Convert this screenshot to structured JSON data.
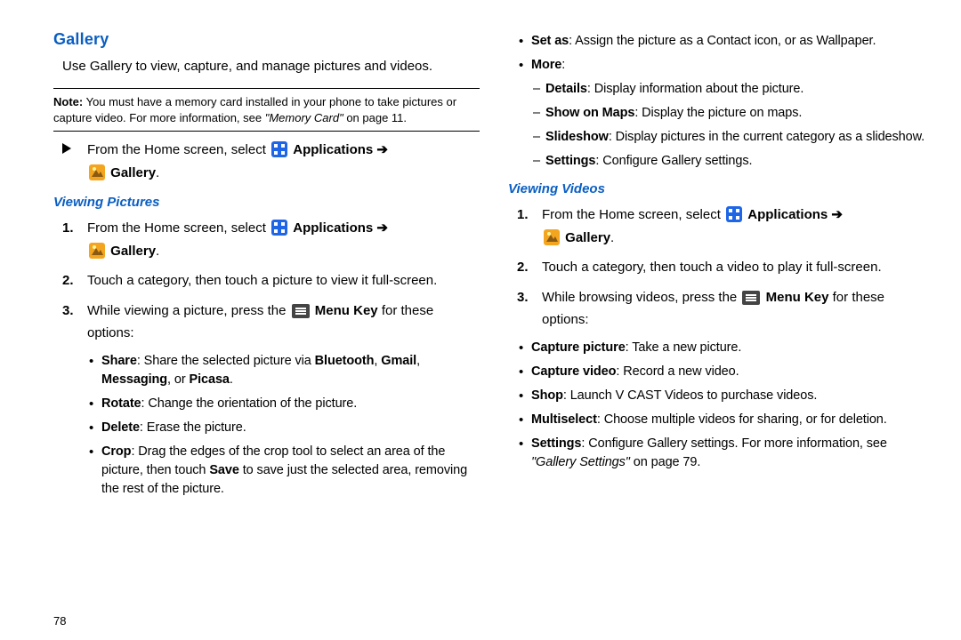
{
  "pageNumber": "78",
  "sectionTitle": "Gallery",
  "intro": "Use Gallery to view, capture, and manage pictures and videos.",
  "note": {
    "label": "Note:",
    "text": "You must have a memory card installed in your phone to take pictures or capture video. For more information, see ",
    "xref": "\"Memory Card\"",
    "tail": " on page 11."
  },
  "navStep": {
    "prefix": "From the Home screen, select ",
    "apps": "Applications",
    "arrow": " ➔ ",
    "gallery": "Gallery",
    "period": "."
  },
  "sub1": "Viewing Pictures",
  "vpSteps": {
    "n1": "1.",
    "s1_prefix": "From the Home screen, select ",
    "s1_apps": "Applications",
    "s1_arrow": " ➔ ",
    "s1_gallery": "Gallery",
    "s1_period": ".",
    "n2": "2.",
    "s2": "Touch a category, then touch a picture to view it full-screen.",
    "n3": "3.",
    "s3_prefix": "While viewing a picture, press the ",
    "s3_menu": "Menu Key",
    "s3_tail": " for these options:"
  },
  "vpBullets": {
    "share": {
      "lead": "Share",
      "rest": ": Share the selected picture via ",
      "a": "Bluetooth",
      "c1": ", ",
      "b": "Gmail",
      "c2": ", ",
      "c": "Messaging",
      "c3": ", or ",
      "d": "Picasa",
      "end": "."
    },
    "rotate": {
      "lead": "Rotate",
      "rest": ": Change the orientation of the picture."
    },
    "delete": {
      "lead": "Delete",
      "rest": ": Erase the picture."
    },
    "crop": {
      "lead": "Crop",
      "rest": ": Drag the edges of the crop tool to select an area of the picture, then touch ",
      "save": "Save",
      "tail": " to save just the selected area, removing the rest of the picture."
    }
  },
  "col2TopBullets": {
    "setas": {
      "lead": "Set as",
      "rest": ": Assign the picture as a Contact icon, or as Wallpaper."
    },
    "more": {
      "lead": "More",
      "rest": ":"
    }
  },
  "moreDashes": {
    "details": {
      "lead": "Details",
      "rest": ": Display information about the picture."
    },
    "showmap": {
      "lead": "Show on Maps",
      "rest": ": Display the picture on maps."
    },
    "slides": {
      "lead": "Slideshow",
      "rest": ": Display pictures in the current category as a slideshow."
    },
    "settings": {
      "lead": "Settings",
      "rest": ": Configure Gallery settings."
    }
  },
  "sub2": "Viewing Videos",
  "vvSteps": {
    "n1": "1.",
    "s1_prefix": "From the Home screen, select ",
    "s1_apps": "Applications",
    "s1_arrow": " ➔ ",
    "s1_gallery": "Gallery",
    "s1_period": ".",
    "n2": "2.",
    "s2": "Touch a category, then touch a video to play it full-screen.",
    "n3": "3.",
    "s3_prefix": "While browsing videos, press the ",
    "s3_menu": "Menu Key",
    "s3_tail": " for these options:"
  },
  "vvBullets": {
    "capPic": {
      "lead": "Capture picture",
      "rest": ": Take a new picture."
    },
    "capVid": {
      "lead": "Capture video",
      "rest": ": Record a new video."
    },
    "shop": {
      "lead": "Shop",
      "rest": ": Launch V CAST Videos to purchase videos."
    },
    "multi": {
      "lead": "Multiselect",
      "rest": ": Choose multiple videos for sharing, or for deletion."
    },
    "settings": {
      "lead": "Settings",
      "rest": ": Configure Gallery settings. For more information, see ",
      "xref": "\"Gallery Settings\"",
      "tail": " on page 79."
    }
  }
}
